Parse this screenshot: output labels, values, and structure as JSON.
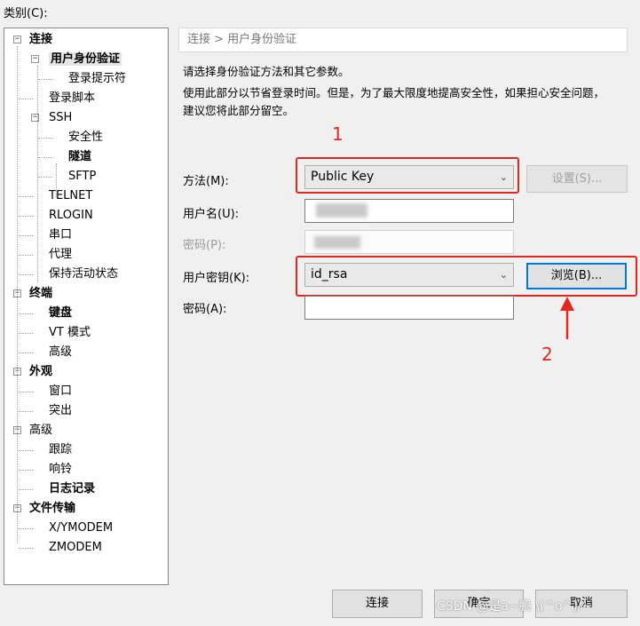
{
  "category_label": "类别(C):",
  "tree": [
    {
      "label": "连接",
      "level": 0,
      "bold": true,
      "expander": "−"
    },
    {
      "label": "用户身份验证",
      "level": 1,
      "bold": true,
      "expander": "−",
      "selected": true
    },
    {
      "label": "登录提示符",
      "level": 2
    },
    {
      "label": "登录脚本",
      "level": 1
    },
    {
      "label": "SSH",
      "level": 1,
      "expander": "−"
    },
    {
      "label": "安全性",
      "level": 2
    },
    {
      "label": "隧道",
      "level": 2,
      "bold": true
    },
    {
      "label": "SFTP",
      "level": 2
    },
    {
      "label": "TELNET",
      "level": 1
    },
    {
      "label": "RLOGIN",
      "level": 1
    },
    {
      "label": "串口",
      "level": 1
    },
    {
      "label": "代理",
      "level": 1
    },
    {
      "label": "保持活动状态",
      "level": 1
    },
    {
      "label": "终端",
      "level": 0,
      "bold": true,
      "expander": "−"
    },
    {
      "label": "键盘",
      "level": 1,
      "bold": true
    },
    {
      "label": "VT 模式",
      "level": 1
    },
    {
      "label": "高级",
      "level": 1
    },
    {
      "label": "外观",
      "level": 0,
      "bold": true,
      "expander": "−"
    },
    {
      "label": "窗口",
      "level": 1
    },
    {
      "label": "突出",
      "level": 1
    },
    {
      "label": "高级",
      "level": 0,
      "expander": "−"
    },
    {
      "label": "跟踪",
      "level": 1
    },
    {
      "label": "响铃",
      "level": 1
    },
    {
      "label": "日志记录",
      "level": 1,
      "bold": true
    },
    {
      "label": "文件传输",
      "level": 0,
      "bold": true,
      "expander": "−"
    },
    {
      "label": "X/YMODEM",
      "level": 1
    },
    {
      "label": "ZMODEM",
      "level": 1
    }
  ],
  "breadcrumb": "连接 > 用户身份验证",
  "intro": "请选择身份验证方法和其它参数。",
  "note_line1": "使用此部分以节省登录时间。但是，为了最大限度地提高安全性，如果担心安全问题，",
  "note_line2": "建议您将此部分留空。",
  "method": {
    "label": "方法(M):",
    "value": "Public Key"
  },
  "settings_button": "设置(S)...",
  "username_label": "用户名(U):",
  "password_label": "密码(P):",
  "userkey": {
    "label": "用户密钥(K):",
    "value": "id_rsa"
  },
  "browse_button": "浏览(B)...",
  "passphrase_label": "密码(A):",
  "annotation_1": "1",
  "annotation_2": "2",
  "buttons": {
    "connect": "连接",
    "ok": "确定",
    "cancel": "取消"
  },
  "watermark": "CSDN @是a~鹏 \\(^o^)/~",
  "colors": {
    "annotation_red": "#e0281e",
    "focus_blue": "#0078d7"
  }
}
